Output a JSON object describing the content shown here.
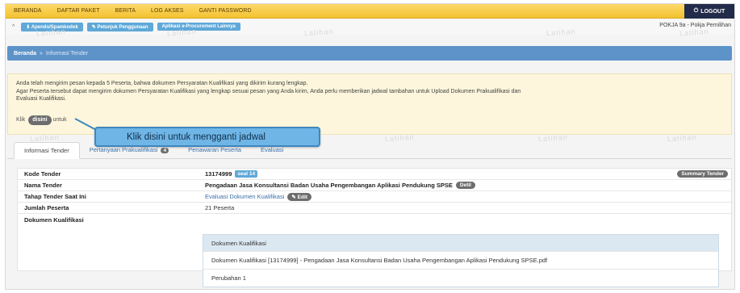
{
  "nav": {
    "items": [
      "BERANDA",
      "DAFTAR PAKET",
      "BERITA",
      "LOG AKSES",
      "GANTI PASSWORD"
    ],
    "logout": "LOGOUT"
  },
  "toolbar": {
    "buttons": [
      "Apendo/Spamkodok",
      "Petunjuk Penggunaan",
      "Aplikasi e-Procurement Lainnya"
    ],
    "user": "POKJA 9a - Pokja Pemilihan"
  },
  "watermark": "Latihan",
  "breadcrumb": {
    "home": "Beranda",
    "separator": "»",
    "current": "Informasi Tender"
  },
  "alert": {
    "line1": "Anda telah mengirim pesan kepada 5 Peserta, bahwa dokumen Persyaratan Kualifikasi yang dikirim kurang lengkap.",
    "line2": "Agar Peserta tersebut dapat mengirim dokumen Persyaratan Kualifikasi yang lengkap sesuai pesan yang Anda kirim, Anda perlu memberikan jadwal tambahan untuk Upload Dokumen Prakualifikasi dan",
    "line3": "Evaluasi Kualifikasi.",
    "klik": "Klik",
    "button": "disini",
    "after": "untuk"
  },
  "tooltip": "Klik disini untuk mengganti jadwal",
  "tabs": [
    {
      "label": "Informasi Tender"
    },
    {
      "label": "Pertanyaan Prakualifikasi",
      "badge": "4"
    },
    {
      "label": "Penawaran Peserta"
    },
    {
      "label": "Evaluasi"
    }
  ],
  "info": {
    "kode_label": "Kode Tender",
    "kode_value": "13174999",
    "kode_tag": "seal 14",
    "summary": "Summary Tender",
    "nama_label": "Nama Tender",
    "nama_value": "Pengadaan Jasa Konsultansi Badan Usaha Pengembangan Aplikasi Pendukung SPSE",
    "nama_tag": "Detil",
    "tahap_label": "Tahap Tender Saat Ini",
    "tahap_value": "Evaluasi Dokumen Kualifikasi",
    "tahap_tag": "Edit",
    "jumlah_label": "Jumlah Peserta",
    "jumlah_value": "21 Peserta",
    "dok_label": "Dokumen Kualifikasi"
  },
  "docs": {
    "head": "Dokumen Kualifikasi",
    "file": "Dokumen Kualifikasi [13174999] - Pengadaan Jasa Konsultansi Badan Usaha Pengembangan Aplikasi Pendukung SPSE.pdf",
    "change": "Perubahan 1"
  }
}
